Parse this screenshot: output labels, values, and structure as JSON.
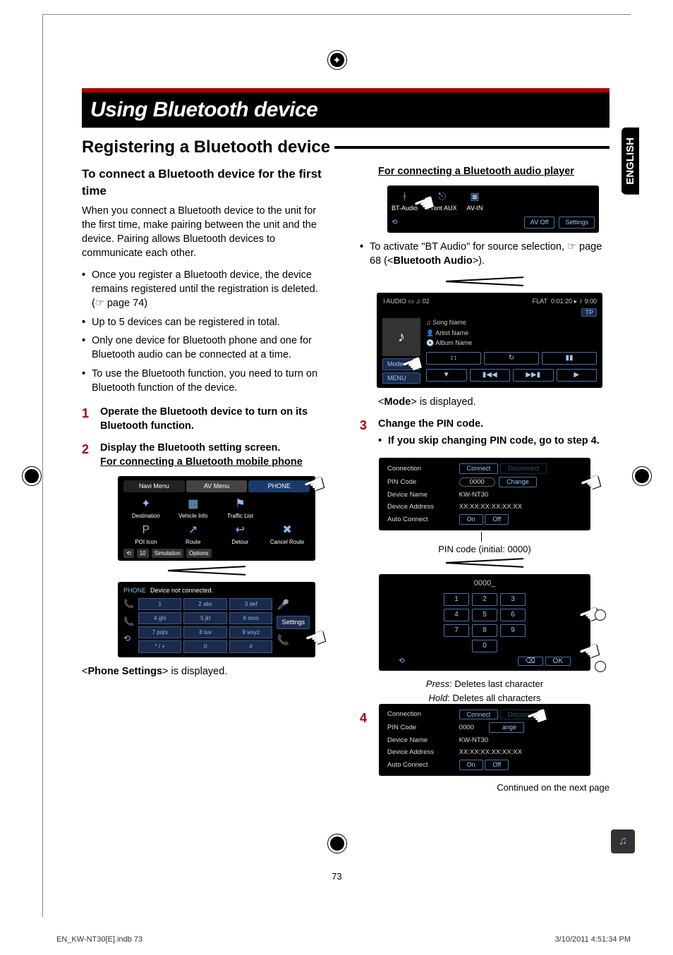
{
  "langtab": "ENGLISH",
  "title": "Using Bluetooth device",
  "subtitle": "Registering a Bluetooth device",
  "left": {
    "heading": "To connect a Bluetooth device for the first time",
    "intro": "When you connect a Bluetooth device to the unit for the first time, make pairing between the unit and the device. Pairing allows Bluetooth devices to communicate each other.",
    "bullets": [
      "Once you register a Bluetooth device, the device remains registered until the registration is deleted. (☞ page 74)",
      "Up to 5 devices can be registered in total.",
      "Only one device for Bluetooth phone and one for Bluetooth audio can be connected at a time.",
      "To use the Bluetooth function, you need to turn on Bluetooth function of the device."
    ],
    "step1": "Operate the Bluetooth device to turn on its Bluetooth function.",
    "step2": "Display the Bluetooth setting screen.",
    "step2u": "For connecting a Bluetooth mobile phone",
    "navi": {
      "tabs": [
        "Navi Menu",
        "AV Menu",
        "PHONE"
      ],
      "items": [
        "Destination",
        "Vehicle Info",
        "Traffic List",
        "",
        "POI Icon",
        "Route",
        "Detour",
        "Cancel Route"
      ],
      "bottom_left": "10",
      "bottom_mid": "Simulation",
      "bottom_right": "Options"
    },
    "phone": {
      "title": "PHONE",
      "status": "Device not connected.",
      "settings": "Settings"
    },
    "phonesettings_line": "<Phone Settings> is displayed."
  },
  "right": {
    "headu": "For connecting a Bluetooth audio player",
    "src": {
      "items": [
        "BT-Audio",
        "Front AUX",
        "AV-IN"
      ],
      "btns": [
        "AV Off",
        "Settings"
      ]
    },
    "activate_pre": "To activate \"BT Audio\" for source selection, ☞ page 68 (<",
    "activate_bold": "Bluetooth Audio",
    "activate_post": ">).",
    "play": {
      "source": "AUDIO",
      "track": "02",
      "eq": "FLAT",
      "time": "0:01:20",
      "clock": "9:00",
      "tp": "TP",
      "song": "Song Name",
      "artist": "Artist Name",
      "album": "Album Name",
      "mode": "Mode",
      "menu": "MENU"
    },
    "mode_line": "<Mode> is displayed.",
    "step3": "Change the PIN code.",
    "step3bullet": "If you skip changing PIN code, go to step 4.",
    "conn": {
      "rows": [
        {
          "k": "Connection",
          "v": "",
          "btns": [
            "Connect",
            "Disconnect"
          ]
        },
        {
          "k": "PIN Code",
          "v": "0000",
          "btns": [
            "Change"
          ]
        },
        {
          "k": "Device Name",
          "v": "KW-NT30"
        },
        {
          "k": "Device Address",
          "v": "XX:XX:XX:XX:XX:XX"
        },
        {
          "k": "Auto Connect",
          "v": "",
          "btns": [
            "On",
            "Off"
          ]
        }
      ]
    },
    "pincap": "PIN code (initial: 0000)",
    "keypad": {
      "disp": "0000_",
      "keys": [
        "1",
        "2",
        "3",
        "4",
        "5",
        "6",
        "7",
        "8",
        "9",
        "",
        "0",
        ""
      ],
      "ok": "OK"
    },
    "press": "Press: Deletes last character",
    "hold": "Hold: Deletes all characters",
    "conn2": {
      "rows": [
        {
          "k": "Connection",
          "v": "",
          "btns": [
            "Connect",
            "Disconnect"
          ]
        },
        {
          "k": "PIN Code",
          "v": "0000",
          "btns": [
            "Change"
          ]
        },
        {
          "k": "Device Name",
          "v": "KW-NT30"
        },
        {
          "k": "Device Address",
          "v": "XX:XX:XX:XX:XX:XX"
        },
        {
          "k": "Auto Connect",
          "v": "",
          "btns": [
            "On",
            "Off"
          ]
        }
      ]
    },
    "cont": "Continued on the next page"
  },
  "pagenum": "73",
  "footer_left": "EN_KW-NT30[E].indb   73",
  "footer_right": "3/10/2011   4:51:34 PM"
}
